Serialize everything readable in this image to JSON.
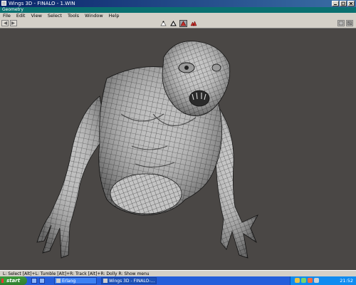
{
  "window": {
    "title": "Wings 3D - FINALO - 1.WIN"
  },
  "geometry_bar": {
    "label": "Geometry"
  },
  "menu": {
    "items": [
      {
        "id": "file",
        "label": "File"
      },
      {
        "id": "edit",
        "label": "Edit"
      },
      {
        "id": "view",
        "label": "View"
      },
      {
        "id": "select",
        "label": "Select"
      },
      {
        "id": "tools",
        "label": "Tools"
      },
      {
        "id": "window",
        "label": "Window"
      },
      {
        "id": "help",
        "label": "Help"
      }
    ]
  },
  "toolbar": {
    "selection_modes": [
      {
        "id": "vertex",
        "icon": "vertex-select-icon",
        "active": false
      },
      {
        "id": "edge",
        "icon": "edge-select-icon",
        "active": false
      },
      {
        "id": "face",
        "icon": "face-select-icon",
        "active": true
      },
      {
        "id": "body",
        "icon": "body-select-icon",
        "active": false
      }
    ],
    "left_icons": [
      "undo-icon",
      "redo-icon"
    ],
    "right_icons": [
      "smooth-preview-icon",
      "view-options-icon"
    ]
  },
  "status_bar": {
    "text": "L: Select  [Alt]+L: Tumble  [Alt]+R: Track  [Alt]+R: Dolly  R: Show menu"
  },
  "taskbar": {
    "start_label": "start",
    "tasks": [
      {
        "label": "Erlang",
        "active": false
      },
      {
        "label": "Wings 3D - FINALO-...",
        "active": true
      }
    ],
    "clock": "21:52"
  },
  "colors": {
    "viewport_bg": "#4a4745",
    "model_fill": "#bdbdbd",
    "wire": "#1a1a1a",
    "active_select": "#c8302a",
    "title_bar": "#0a246a"
  }
}
